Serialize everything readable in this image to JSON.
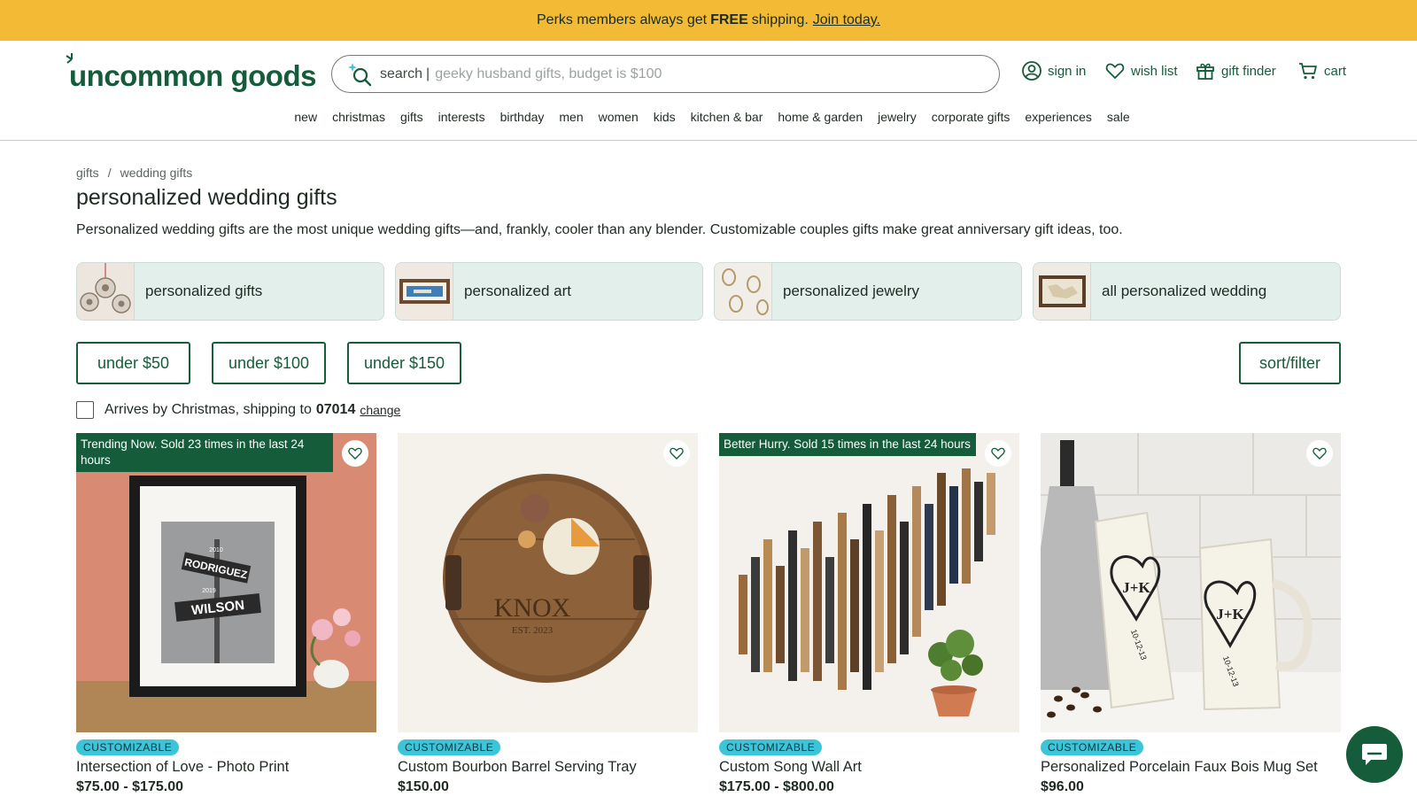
{
  "promo": {
    "text_before": "Perks members always get",
    "bold": "FREE",
    "text_after": "shipping.",
    "link": "Join today."
  },
  "header": {
    "logo": "uncommon goods",
    "search": {
      "label": "search",
      "separator": "|",
      "placeholder": "geeky husband gifts, budget is $100"
    },
    "utility": {
      "sign_in": "sign in",
      "wish_list": "wish list",
      "gift_finder": "gift finder",
      "cart": "cart"
    },
    "nav": [
      "new",
      "christmas",
      "gifts",
      "interests",
      "birthday",
      "men",
      "women",
      "kids",
      "kitchen & bar",
      "home & garden",
      "jewelry",
      "corporate gifts",
      "experiences",
      "sale"
    ]
  },
  "breadcrumb": {
    "items": [
      "gifts",
      "wedding gifts"
    ],
    "separator": "/"
  },
  "page": {
    "title": "personalized wedding gifts",
    "description": "Personalized wedding gifts are the most unique wedding gifts—and, frankly, cooler than any blender. Customizable couples gifts make great anniversary gift ideas, too."
  },
  "categories": [
    {
      "label": "personalized gifts"
    },
    {
      "label": "personalized art"
    },
    {
      "label": "personalized jewelry"
    },
    {
      "label": "all personalized wedding"
    }
  ],
  "filters": {
    "price": [
      "under $50",
      "under $100",
      "under $150"
    ],
    "sort_filter": "sort/filter"
  },
  "arrives": {
    "text": "Arrives by Christmas, shipping to",
    "zip": "07014",
    "change": "change",
    "checked": false
  },
  "products": [
    {
      "badge": "Trending Now. Sold 23 times in the last 24 hours",
      "tag": "CUSTOMIZABLE",
      "name": "Intersection of Love - Photo Print",
      "price": "$75.00 - $175.00",
      "art": {
        "sign1": "RODRIGUEZ",
        "sign2": "WILSON",
        "year1": "2010",
        "year2": "2019"
      }
    },
    {
      "badge": "",
      "tag": "CUSTOMIZABLE",
      "name": "Custom Bourbon Barrel Serving Tray",
      "price": "$150.00",
      "art": {
        "engraving": "KNOX",
        "est": "EST. 2023"
      }
    },
    {
      "badge": "Better Hurry. Sold 15 times in the last 24 hours",
      "tag": "CUSTOMIZABLE",
      "name": "Custom Song Wall Art",
      "price": "$175.00 - $800.00"
    },
    {
      "badge": "",
      "tag": "CUSTOMIZABLE",
      "name": "Personalized Porcelain Faux Bois Mug Set",
      "price": "$96.00",
      "art": {
        "initials": "J+K",
        "date": "10-12-13"
      }
    }
  ],
  "colors": {
    "brand_green": "#155c3a",
    "promo_yellow": "#f3bb35",
    "tag_cyan": "#3cc4d8",
    "category_bg": "#e2efeb"
  }
}
